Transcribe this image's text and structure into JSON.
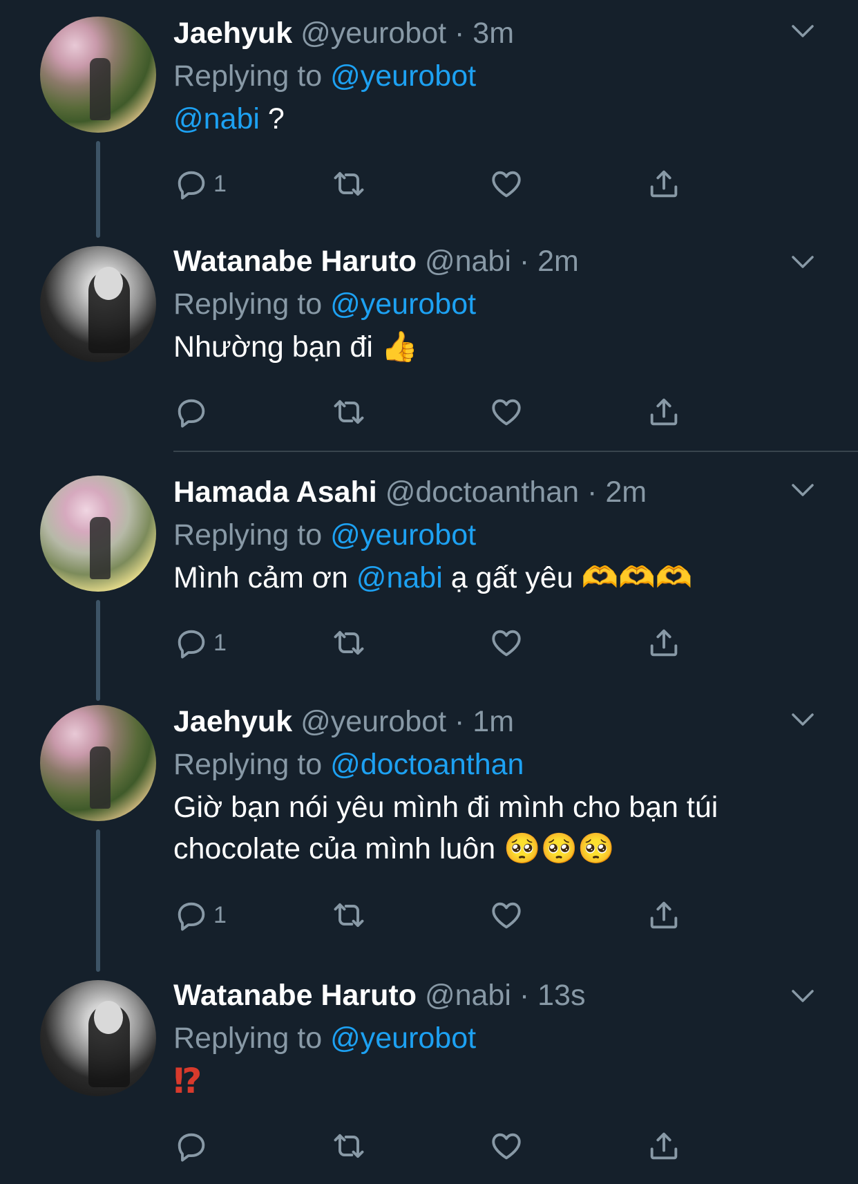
{
  "tweets": [
    {
      "name": "Jaehyuk",
      "handle": "@yeurobot",
      "dot": "·",
      "time": "3m",
      "replying_prefix": "Replying to",
      "replying_to": "@yeurobot",
      "body_mention": "@nabi",
      "body_text": " ?",
      "reply_count": "1"
    },
    {
      "name": "Watanabe Haruto",
      "handle": "@nabi",
      "dot": "·",
      "time": "2m",
      "replying_prefix": "Replying to",
      "replying_to": "@yeurobot",
      "body_text": "Nhường bạn đi",
      "emoji": "👍",
      "reply_count": ""
    },
    {
      "name": "Hamada Asahi",
      "handle": "@doctoanthan",
      "dot": "·",
      "time": "2m",
      "replying_prefix": "Replying to",
      "replying_to": "@yeurobot",
      "body_before": "Mình cảm ơn ",
      "body_mention": "@nabi",
      "body_after": " ạ gất yêu",
      "emoji": "🫶🫶🫶",
      "reply_count": "1"
    },
    {
      "name": "Jaehyuk",
      "handle": "@yeurobot",
      "dot": "·",
      "time": "1m",
      "replying_prefix": "Replying to",
      "replying_to": "@doctoanthan",
      "body_line1": "Giờ bạn nói yêu mình đi mình cho bạn túi",
      "body_line2": "chocolate của mình luôn",
      "emoji": "🥺🥺🥺",
      "reply_count": "1"
    },
    {
      "name": "Watanabe Haruto",
      "handle": "@nabi",
      "dot": "·",
      "time": "13s",
      "replying_prefix": "Replying to",
      "replying_to": "@yeurobot",
      "body_text": "⁉",
      "reply_count": ""
    }
  ],
  "icons": {
    "reply": "reply-icon",
    "retweet": "retweet-icon",
    "like": "heart-icon",
    "share": "share-icon",
    "more": "chevron-down-icon"
  },
  "colors": {
    "background": "#15202b",
    "accent": "#1da1f2",
    "muted": "#8899a6"
  }
}
